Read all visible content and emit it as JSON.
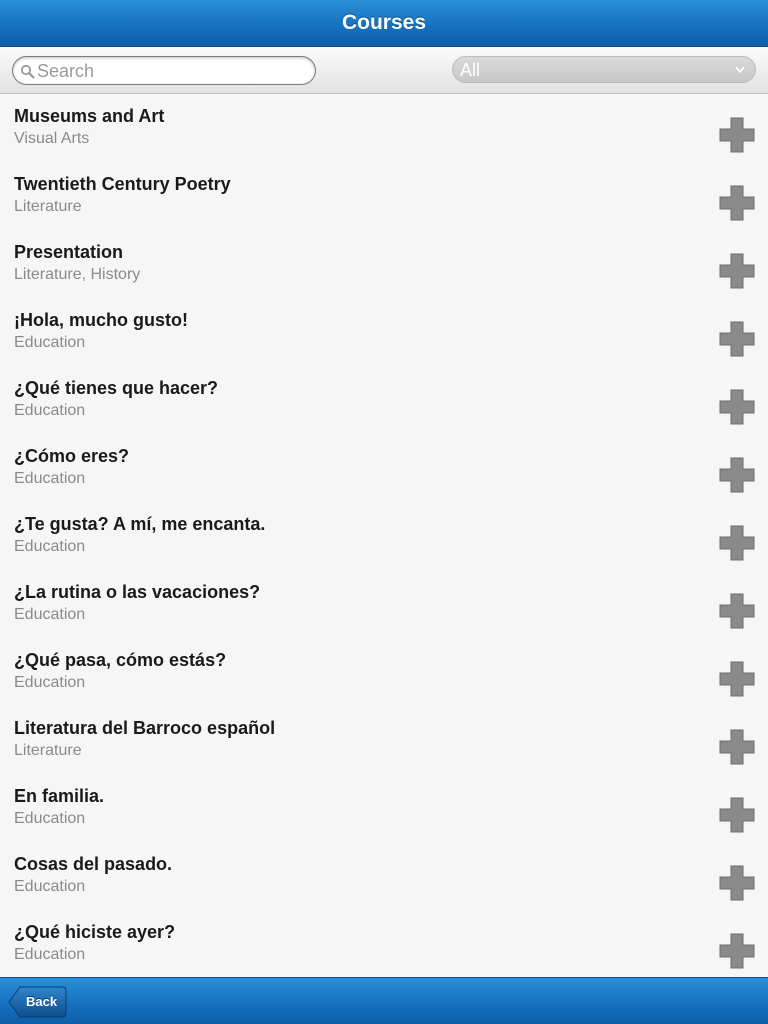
{
  "header": {
    "title": "Courses"
  },
  "search": {
    "placeholder": "Search",
    "value": ""
  },
  "filter": {
    "selected": "All"
  },
  "courses": [
    {
      "title": "Museums and Art",
      "category": "Visual Arts"
    },
    {
      "title": "Twentieth Century Poetry",
      "category": "Literature"
    },
    {
      "title": "Presentation",
      "category": "Literature, History"
    },
    {
      "title": "¡Hola, mucho gusto!",
      "category": "Education"
    },
    {
      "title": "¿Qué tienes que hacer?",
      "category": "Education"
    },
    {
      "title": "¿Cómo eres?",
      "category": "Education"
    },
    {
      "title": "¿Te gusta? A mí, me encanta.",
      "category": "Education"
    },
    {
      "title": "¿La rutina o las vacaciones?",
      "category": "Education"
    },
    {
      "title": "¿Qué pasa, cómo estás?",
      "category": "Education"
    },
    {
      "title": "Literatura del Barroco español",
      "category": "Literature"
    },
    {
      "title": "En familia.",
      "category": "Education"
    },
    {
      "title": "Cosas del pasado.",
      "category": "Education"
    },
    {
      "title": "¿Qué hiciste ayer?",
      "category": "Education"
    }
  ],
  "icons": {
    "add": "plus-icon",
    "search": "search-icon",
    "dropdown": "chevron-down-icon"
  },
  "footer": {
    "back_label": "Back"
  },
  "colors": {
    "bar": "#1672bf",
    "add_icon": "#8a8a8a"
  }
}
